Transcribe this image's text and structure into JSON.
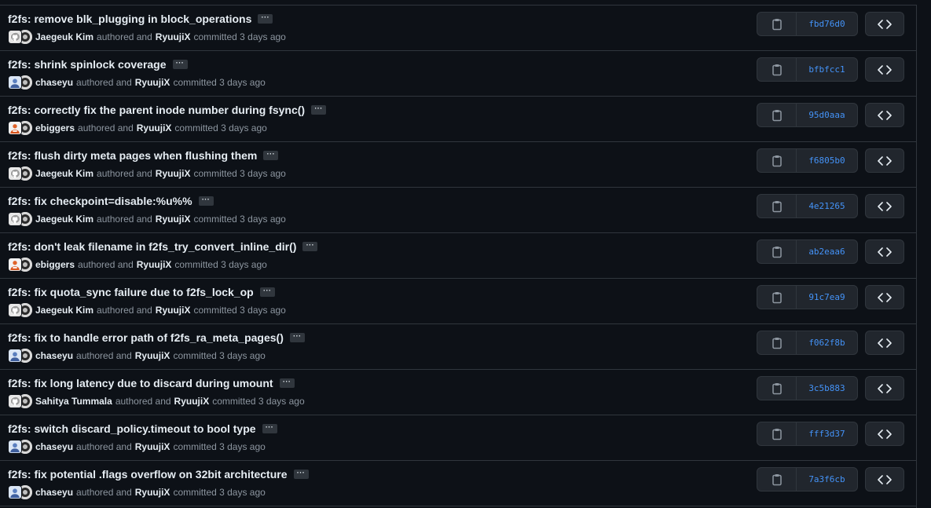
{
  "ellipsis_label": "···",
  "authored_text": "authored and",
  "committed_text": "committed",
  "colors": {
    "background": "#0d1117",
    "border": "#30363d",
    "text": "#e6edf3",
    "muted": "#8d96a0",
    "sha": "#4493f8"
  },
  "commits": [
    {
      "title": "f2fs: remove blk_plugging in block_operations",
      "author": "Jaegeuk Kim",
      "author_avatar": "github-default",
      "committer": "RyuujiX",
      "time": "3 days ago",
      "sha": "fbd76d0"
    },
    {
      "title": "f2fs: shrink spinlock coverage",
      "author": "chaseyu",
      "author_avatar": "user-photo-blue",
      "committer": "RyuujiX",
      "time": "3 days ago",
      "sha": "bfbfcc1"
    },
    {
      "title": "f2fs: correctly fix the parent inode number during fsync()",
      "author": "ebiggers",
      "author_avatar": "user-photo-orange",
      "committer": "RyuujiX",
      "time": "3 days ago",
      "sha": "95d0aaa"
    },
    {
      "title": "f2fs: flush dirty meta pages when flushing them",
      "author": "Jaegeuk Kim",
      "author_avatar": "github-default",
      "committer": "RyuujiX",
      "time": "3 days ago",
      "sha": "f6805b0"
    },
    {
      "title": "f2fs: fix checkpoint=disable:%u%%",
      "author": "Jaegeuk Kim",
      "author_avatar": "github-default",
      "committer": "RyuujiX",
      "time": "3 days ago",
      "sha": "4e21265"
    },
    {
      "title": "f2fs: don't leak filename in f2fs_try_convert_inline_dir()",
      "author": "ebiggers",
      "author_avatar": "user-photo-orange",
      "committer": "RyuujiX",
      "time": "3 days ago",
      "sha": "ab2eaa6"
    },
    {
      "title": "f2fs: fix quota_sync failure due to f2fs_lock_op",
      "author": "Jaegeuk Kim",
      "author_avatar": "github-default",
      "committer": "RyuujiX",
      "time": "3 days ago",
      "sha": "91c7ea9"
    },
    {
      "title": "f2fs: fix to handle error path of f2fs_ra_meta_pages()",
      "author": "chaseyu",
      "author_avatar": "user-photo-blue",
      "committer": "RyuujiX",
      "time": "3 days ago",
      "sha": "f062f8b"
    },
    {
      "title": "f2fs: fix long latency due to discard during umount",
      "author": "Sahitya Tummala",
      "author_avatar": "github-default",
      "committer": "RyuujiX",
      "time": "3 days ago",
      "sha": "3c5b883"
    },
    {
      "title": "f2fs: switch discard_policy.timeout to bool type",
      "author": "chaseyu",
      "author_avatar": "user-photo-blue",
      "committer": "RyuujiX",
      "time": "3 days ago",
      "sha": "fff3d37"
    },
    {
      "title": "f2fs: fix potential .flags overflow on 32bit architecture",
      "author": "chaseyu",
      "author_avatar": "user-photo-blue",
      "committer": "RyuujiX",
      "time": "3 days ago",
      "sha": "7a3f6cb"
    }
  ]
}
